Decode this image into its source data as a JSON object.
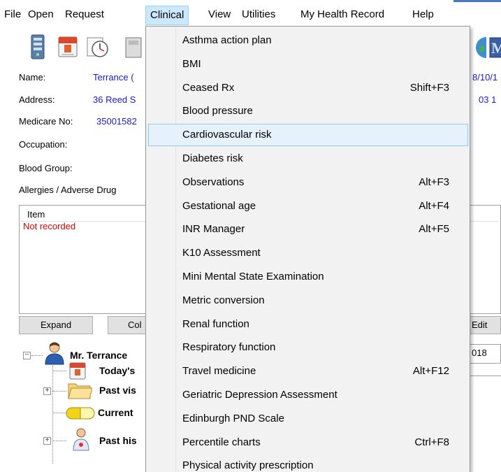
{
  "menubar": {
    "items": [
      "File",
      "Open",
      "Request",
      "Clinical",
      "View",
      "Utilities",
      "My Health Record",
      "Help"
    ]
  },
  "patient": {
    "name_label": "Name:",
    "name_value": "Terrance (",
    "address_label": "Address:",
    "address_value": "36 Reed S",
    "medicare_label": "Medicare No:",
    "medicare_value": "35001582",
    "occupation_label": "Occupation:",
    "blood_group_label": "Blood Group:",
    "allergies_label": "Allergies / Adverse Drug",
    "right_top_value": "8/10/1",
    "right_phone_value": "03 1"
  },
  "allergy_list": {
    "column_header": "Item",
    "empty_value": "Not recorded"
  },
  "buttons": {
    "expand": "Expand",
    "collapse_partial": "Col",
    "edit": "Edit"
  },
  "tree": {
    "root_label": "Mr. Terrance",
    "today_label": "Today's",
    "past_visits_label": "Past vis",
    "current_label": "Current",
    "past_history_label": "Past his",
    "date_value": "018"
  },
  "clinical_menu": {
    "highlighted_index": 4,
    "items": [
      {
        "label": "Asthma action plan",
        "shortcut": ""
      },
      {
        "label": "BMI",
        "shortcut": ""
      },
      {
        "label": "Ceased Rx",
        "shortcut": "Shift+F3"
      },
      {
        "label": "Blood pressure",
        "shortcut": ""
      },
      {
        "label": "Cardiovascular risk",
        "shortcut": ""
      },
      {
        "label": "Diabetes risk",
        "shortcut": ""
      },
      {
        "label": "Observations",
        "shortcut": "Alt+F3"
      },
      {
        "label": "Gestational age",
        "shortcut": "Alt+F4"
      },
      {
        "label": "INR Manager",
        "shortcut": "Alt+F5"
      },
      {
        "label": "K10 Assessment",
        "shortcut": ""
      },
      {
        "label": "Mini Mental State Examination",
        "shortcut": ""
      },
      {
        "label": "Metric conversion",
        "shortcut": ""
      },
      {
        "label": "Renal function",
        "shortcut": ""
      },
      {
        "label": "Respiratory function",
        "shortcut": ""
      },
      {
        "label": "Travel medicine",
        "shortcut": "Alt+F12"
      },
      {
        "label": "Geriatric Depression Assessment",
        "shortcut": ""
      },
      {
        "label": "Edinburgh PND Scale",
        "shortcut": ""
      },
      {
        "label": "Percentile charts",
        "shortcut": "Ctrl+F8"
      },
      {
        "label": "Physical activity prescription",
        "shortcut": ""
      }
    ]
  },
  "colors": {
    "menu_background": "#f2f2f2",
    "highlight_fill": "#e5f1fb",
    "highlight_border": "#99c9ef",
    "open_menu_fill": "#cce8ff",
    "link_blue": "#1a1acd",
    "error_red": "#e00000"
  },
  "icons": [
    "server-icon",
    "calendar-icon",
    "clock-icon",
    "printer-icon",
    "globe-icon",
    "patient-avatar-icon",
    "calendar-small-icon",
    "folder-icon",
    "pill-icon",
    "doctor-icon"
  ]
}
